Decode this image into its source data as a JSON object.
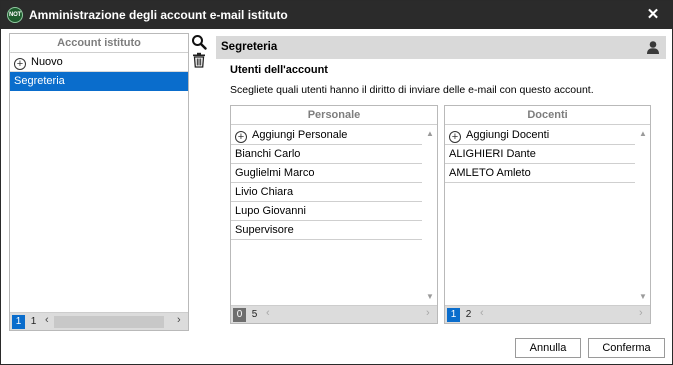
{
  "window": {
    "badge": "NOT",
    "title": "Amministrazione degli account e-mail istituto",
    "close_glyph": "✕"
  },
  "accounts": {
    "header": "Account istituto",
    "add_label": "Nuovo",
    "items": [
      "Segreteria"
    ],
    "selected": "Segreteria",
    "pages": [
      "1",
      "1"
    ]
  },
  "tools": {
    "search_icon": "search-icon",
    "delete_icon": "trash-icon"
  },
  "detail": {
    "header": "Segreteria",
    "section_title": "Utenti dell'account",
    "description": "Scegliete quali utenti hanno il diritto di inviare delle e-mail con questo account."
  },
  "personale": {
    "header": "Personale",
    "add_label": "Aggiungi Personale",
    "items": [
      "Bianchi Carlo",
      "Guglielmi Marco",
      "Livio Chiara",
      "Lupo Giovanni",
      "Supervisore"
    ],
    "pages": [
      "0",
      "5"
    ]
  },
  "docenti": {
    "header": "Docenti",
    "add_label": "Aggiungi Docenti",
    "items": [
      "ALIGHIERI Dante",
      "AMLETO Amleto"
    ],
    "pages": [
      "1",
      "2"
    ]
  },
  "buttons": {
    "cancel": "Annulla",
    "confirm": "Conferma"
  },
  "colors": {
    "selection": "#0a6dcc",
    "titlebar": "#2b2b2b",
    "header_band": "#d9d9d9"
  }
}
